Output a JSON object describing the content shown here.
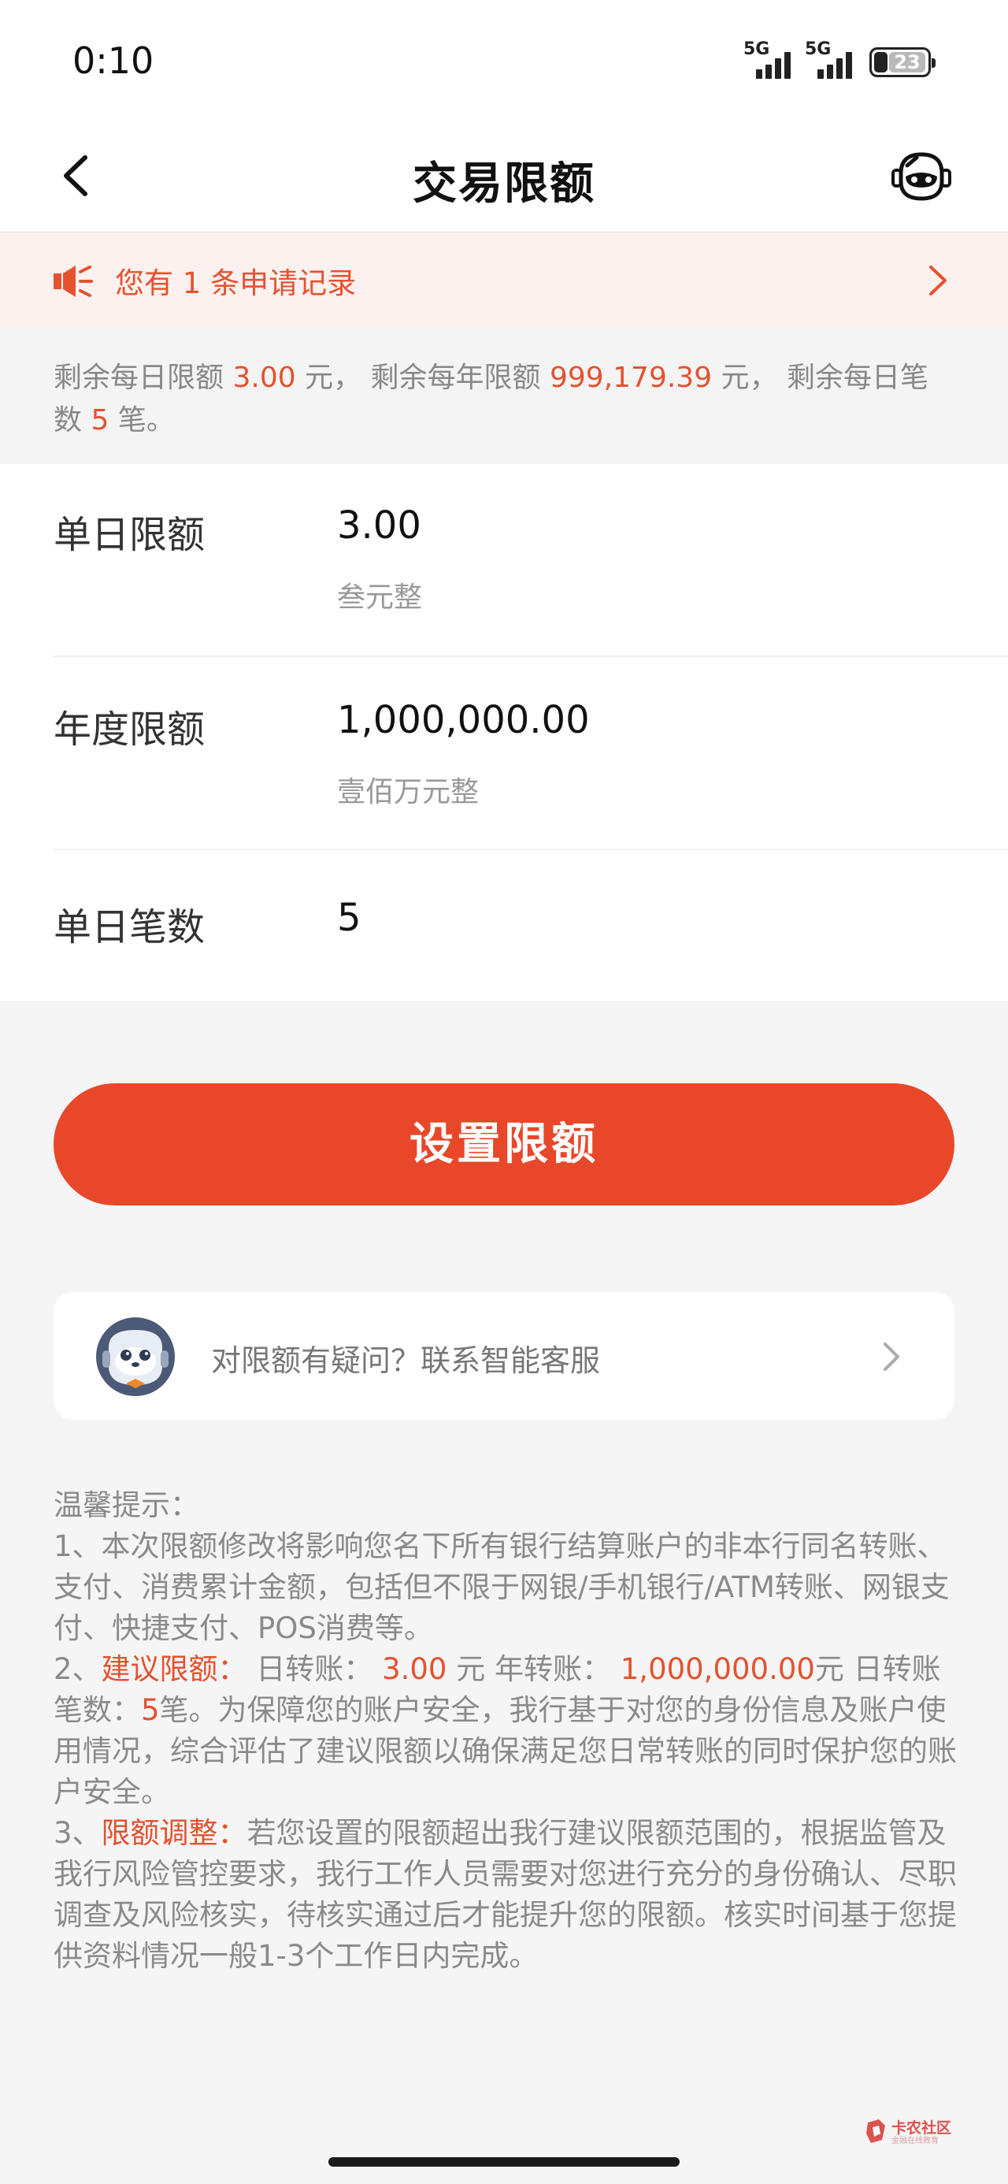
{
  "status_bar": {
    "time": "0:10",
    "signal_1": "5G",
    "signal_2": "5G",
    "battery": "23"
  },
  "nav": {
    "title": "交易限额"
  },
  "notice": {
    "prefix": "您有",
    "count": "1",
    "suffix": "条申请记录"
  },
  "remaining": {
    "daily_label": "剩余每日限额",
    "daily_value": "3.00",
    "yearly_label": "元， 剩余每年限额",
    "yearly_value": "999,179.39",
    "count_label": "元， 剩余每日笔数",
    "count_value": "5",
    "count_unit": "笔。"
  },
  "limits": [
    {
      "label": "单日限额",
      "value": "3.00",
      "sub": "叁元整"
    },
    {
      "label": "年度限额",
      "value": "1,000,000.00",
      "sub": "壹佰万元整"
    },
    {
      "label": "单日笔数",
      "value": "5"
    }
  ],
  "set_button": "设置限额",
  "service": {
    "text": "对限额有疑问？联系智能客服"
  },
  "tips": {
    "title": "温馨提示：",
    "item1": "1、本次限额修改将影响您名下所有银行结算账户的非本行同名转账、支付、消费累计金额，包括但不限于网银/手机银行/ATM转账、网银支付、快捷支付、POS消费等。",
    "item2_prefix": "2、",
    "item2_hl": "建议限额：",
    "item2_a": " 日转账：",
    "item2_v1": " 3.00",
    "item2_b": " 元 年转账：",
    "item2_v2": " 1,000,000.00",
    "item2_c": "元 日转账笔数：",
    "item2_v3": "5",
    "item2_d": "笔。为保障您的账户安全，我行基于对您的身份信息及账户使用情况，综合评估了建议限额以确保满足您日常转账的同时保护您的账户安全。",
    "item3_prefix": "3、",
    "item3_hl": "限额调整：",
    "item3_text": "若您设置的限额超出我行建议限额范围的，根据监管及我行风险管控要求，我行工作人员需要对您进行充分的身份确认、尽职调查及风险核实，待核实通过后才能提升您的限额。核实时间基于您提供资料情况一般1-3个工作日内完成。"
  },
  "watermark": {
    "text": "卡农社区",
    "sub": "金融在线教育"
  },
  "colors": {
    "accent": "#e9472a",
    "highlight": "#e4522f",
    "notice_bg": "#fdf1ef"
  },
  "icons": [
    "chevron-left-icon",
    "robot-service-icon",
    "speaker-icon",
    "chevron-right-icon",
    "service-avatar-icon"
  ]
}
